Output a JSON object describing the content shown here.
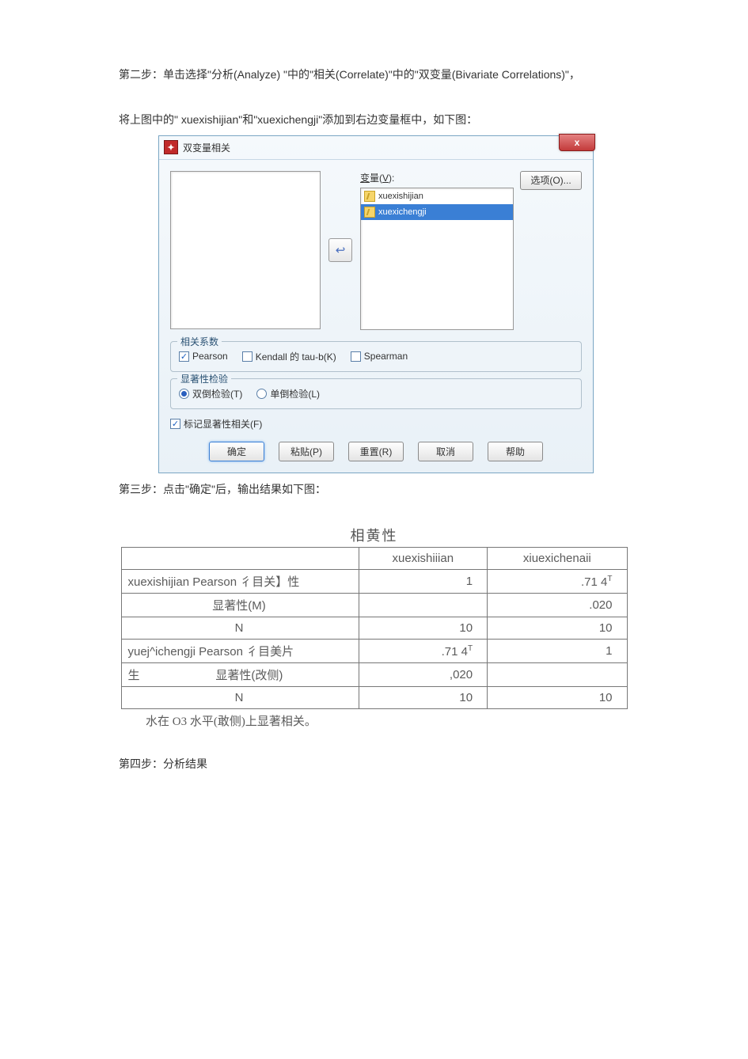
{
  "doc": {
    "para1": "第二步：单击选择\"分析(Analyze) \"中的\"相关(Correlate)\"中的\"双变量(Bivariate Correlations)\"，",
    "para2": "将上图中的\" xuexishijian\"和\"xuexichengji\"添加到右边变量框中，如下图：",
    "para3": "第三步：点击\"确定\"后，输出结果如下图：",
    "para4": "第四步：分析结果",
    "footnote": "水在 O3 水平(敢侧)上显著相关。"
  },
  "dialog": {
    "title": "双变量相关",
    "close": "x",
    "variables_label": "变量(V):",
    "items": [
      {
        "label": "xuexishijian",
        "selected": false
      },
      {
        "label": "xuexichengji",
        "selected": true
      }
    ],
    "options_button": "选项(O)...",
    "corr_legend": "相关系数",
    "corrs": {
      "pearson": {
        "label": "Pearson",
        "checked": true
      },
      "kendall": {
        "label": "Kendall 的 tau-b(K)",
        "checked": false
      },
      "spearman": {
        "label": "Spearman",
        "checked": false
      }
    },
    "sig_legend": "显著性检验",
    "sig": {
      "two": {
        "label": "双倒检验(T)",
        "checked": true
      },
      "one": {
        "label": "单倒检验(L)",
        "checked": false
      }
    },
    "flag": {
      "label": "标记显著性相关(F)",
      "checked": true
    },
    "buttons": {
      "ok": "确定",
      "paste": "粘贴(P)",
      "reset": "重置(R)",
      "cancel": "取消",
      "help": "帮助"
    }
  },
  "output": {
    "title": "相黄性",
    "col1": "xuexishiiian",
    "col2": "xiuexichenaii",
    "rows": [
      {
        "hdr": "xuexishijian Pearson 彳目关】性",
        "center": false,
        "v1": "1",
        "v2": ".71 4",
        "sup2": "T"
      },
      {
        "hdr": "显著性(M)",
        "center": true,
        "v1": "",
        "v2": ".020"
      },
      {
        "hdr": "N",
        "center": true,
        "v1": "10",
        "v2": "10"
      },
      {
        "hdr": "yuej^ichengji Pearson 彳目美片",
        "center": false,
        "v1": ".71 4",
        "sup1": "T",
        "v2": "1"
      },
      {
        "hdr": "生                       显著性(改侧)",
        "center": false,
        "v1": ",020",
        "v2": ""
      },
      {
        "hdr": "N",
        "center": true,
        "v1": "10",
        "v2": "10"
      }
    ]
  }
}
